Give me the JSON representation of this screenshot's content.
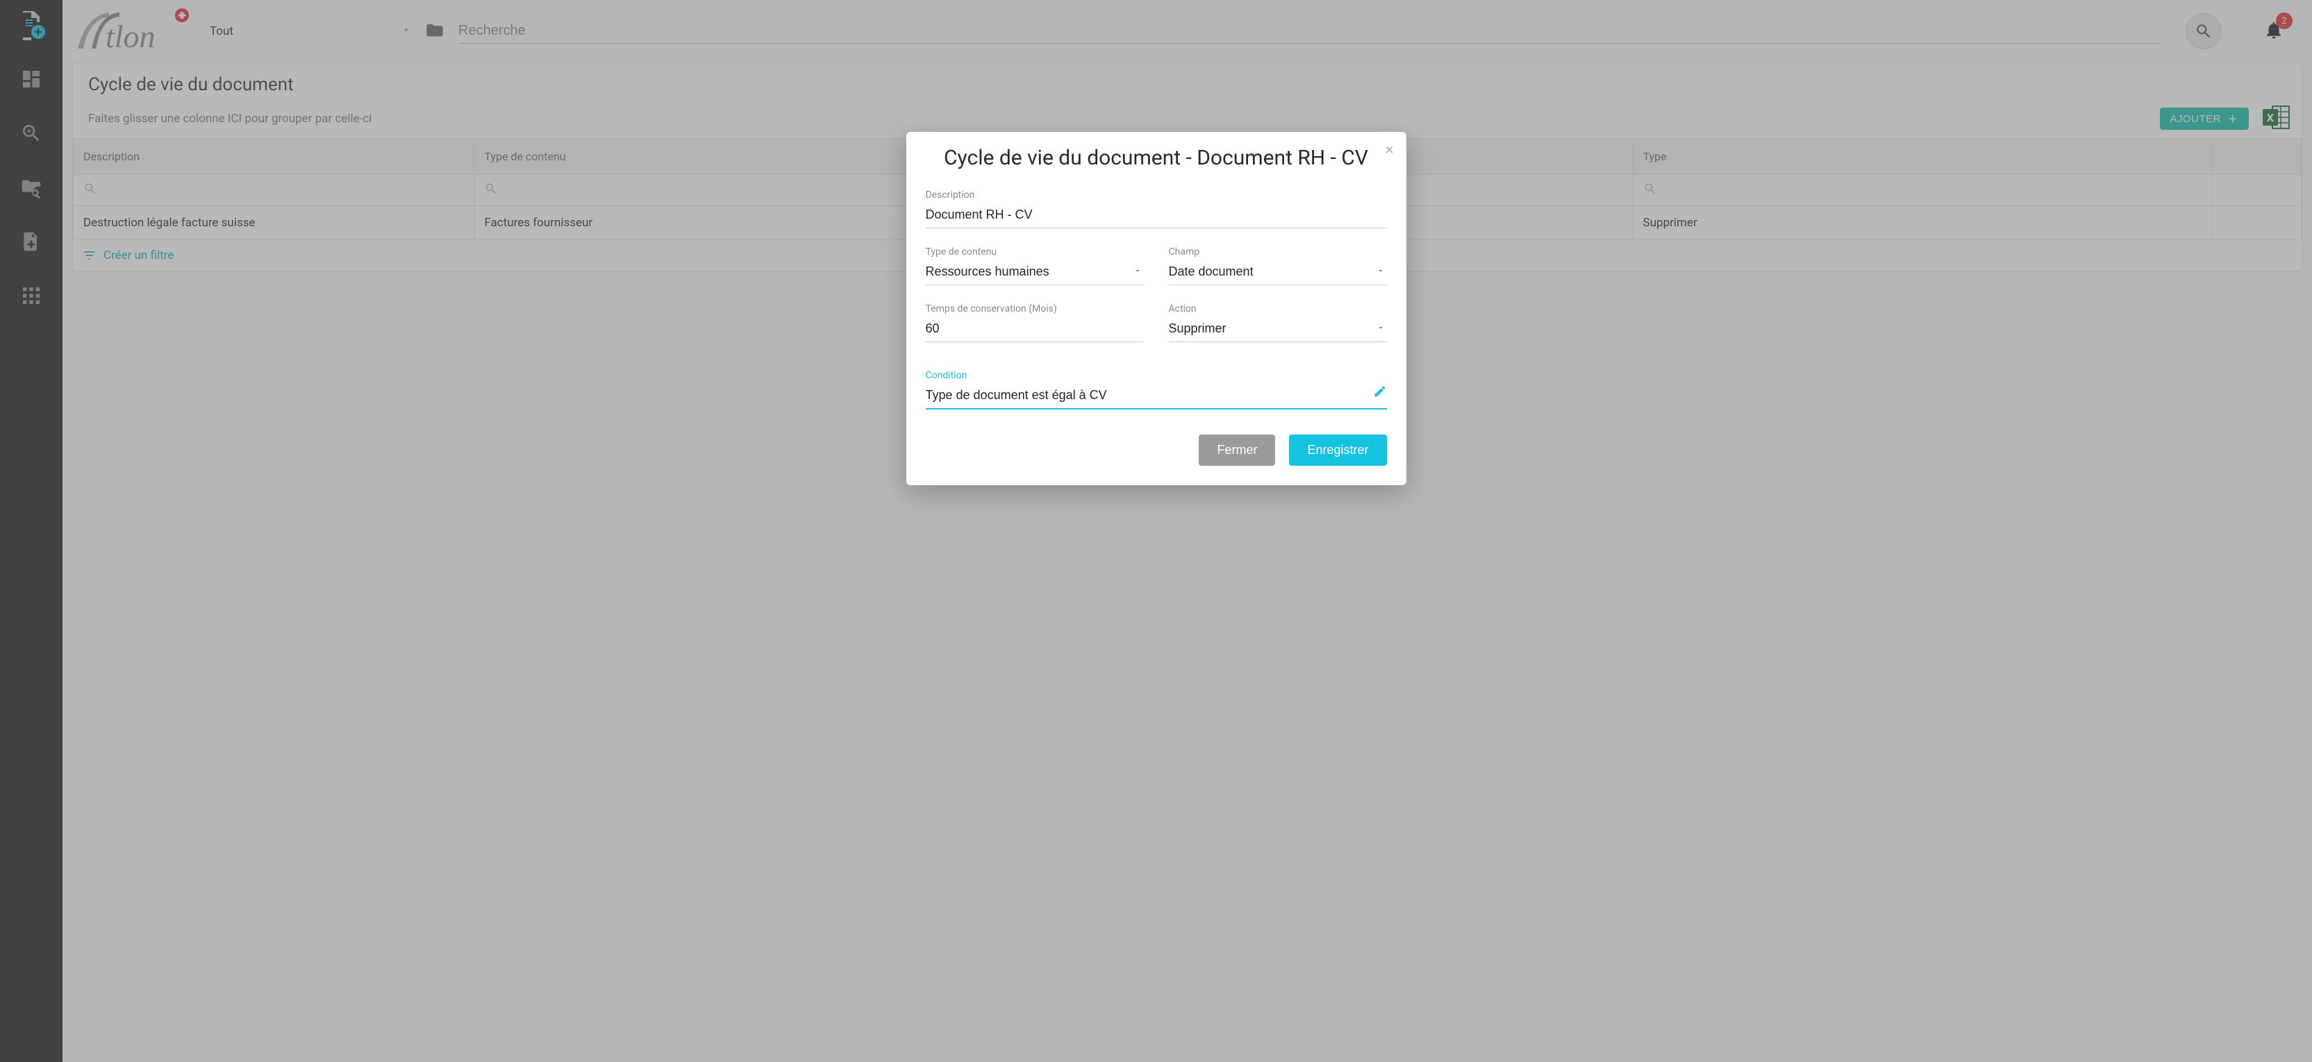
{
  "header": {
    "type_filter_value": "Tout",
    "search_placeholder": "Recherche",
    "notification_count": "2"
  },
  "page": {
    "title": "Cycle de vie du document",
    "group_hint": "Faites glisser une colonne ICI pour grouper par celle-ci",
    "add_button": "AJOUTER",
    "columns": {
      "description": "Description",
      "type_contenu": "Type de contenu",
      "type": "Type"
    },
    "rows": [
      {
        "description": "Destruction légale facture suisse",
        "type_contenu": "Factures fournisseur",
        "type": "Supprimer"
      }
    ],
    "create_filter": "Créer un filtre"
  },
  "modal": {
    "title": "Cycle de vie du document - Document RH - CV",
    "fields": {
      "description_label": "Description",
      "description_value": "Document RH - CV",
      "type_contenu_label": "Type de contenu",
      "type_contenu_value": "Ressources humaines",
      "champ_label": "Champ",
      "champ_value": "Date document",
      "temps_label": "Temps de conservation (Mois)",
      "temps_value": "60",
      "action_label": "Action",
      "action_value": "Supprimer",
      "condition_label": "Condition",
      "condition_value": "Type de document est égal à CV"
    },
    "buttons": {
      "close": "Fermer",
      "save": "Enregistrer"
    }
  }
}
